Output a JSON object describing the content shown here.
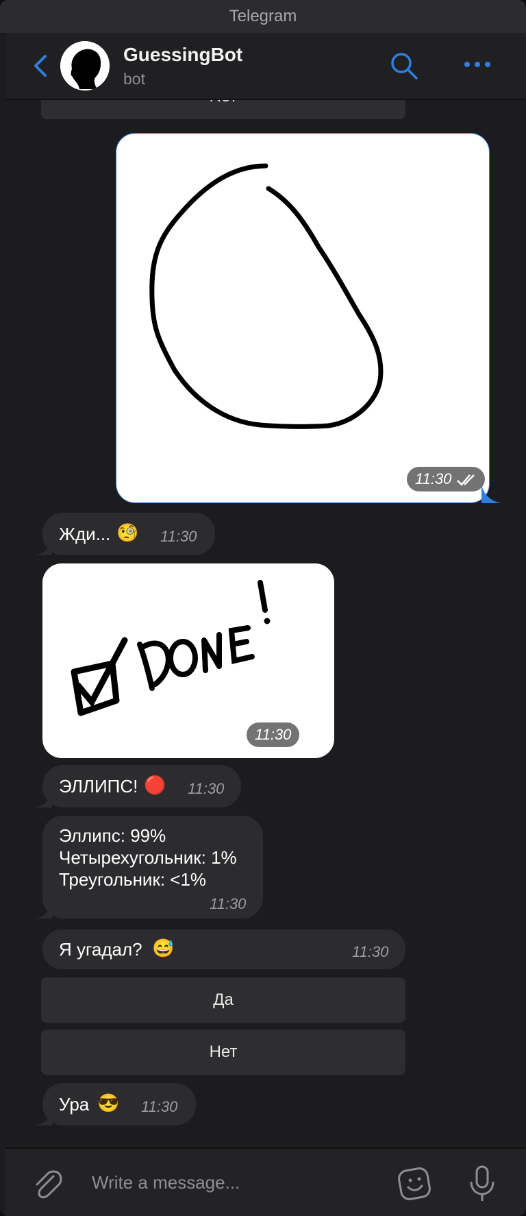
{
  "app": {
    "title": "Telegram"
  },
  "header": {
    "name": "GuessingBot",
    "subtitle": "bot"
  },
  "messages": {
    "top_button": "Нет",
    "drawing_time": "11:30",
    "wait": {
      "text": "Жди...",
      "emoji": "🧐",
      "time": "11:30"
    },
    "done_sticker": {
      "time": "11:30"
    },
    "result": {
      "text": "ЭЛЛИПС!",
      "emoji": "🔴",
      "time": "11:30"
    },
    "stats": {
      "line1": "Эллипс: 99%",
      "line2": "Четырехугольник: 1%",
      "line3": "Треугольник: <1%",
      "time": "11:30"
    },
    "question": {
      "text": "Я угадал?",
      "emoji": "😅",
      "time": "11:30"
    },
    "buttons": {
      "yes": "Да",
      "no": "Нет"
    },
    "final": {
      "text": "Ура",
      "emoji": "😎",
      "time": "11:30"
    }
  },
  "composer": {
    "placeholder": "Write a message..."
  },
  "colors": {
    "accent": "#2f7fe0",
    "background": "#1c1c1e",
    "bubble": "#2c2c2e"
  }
}
